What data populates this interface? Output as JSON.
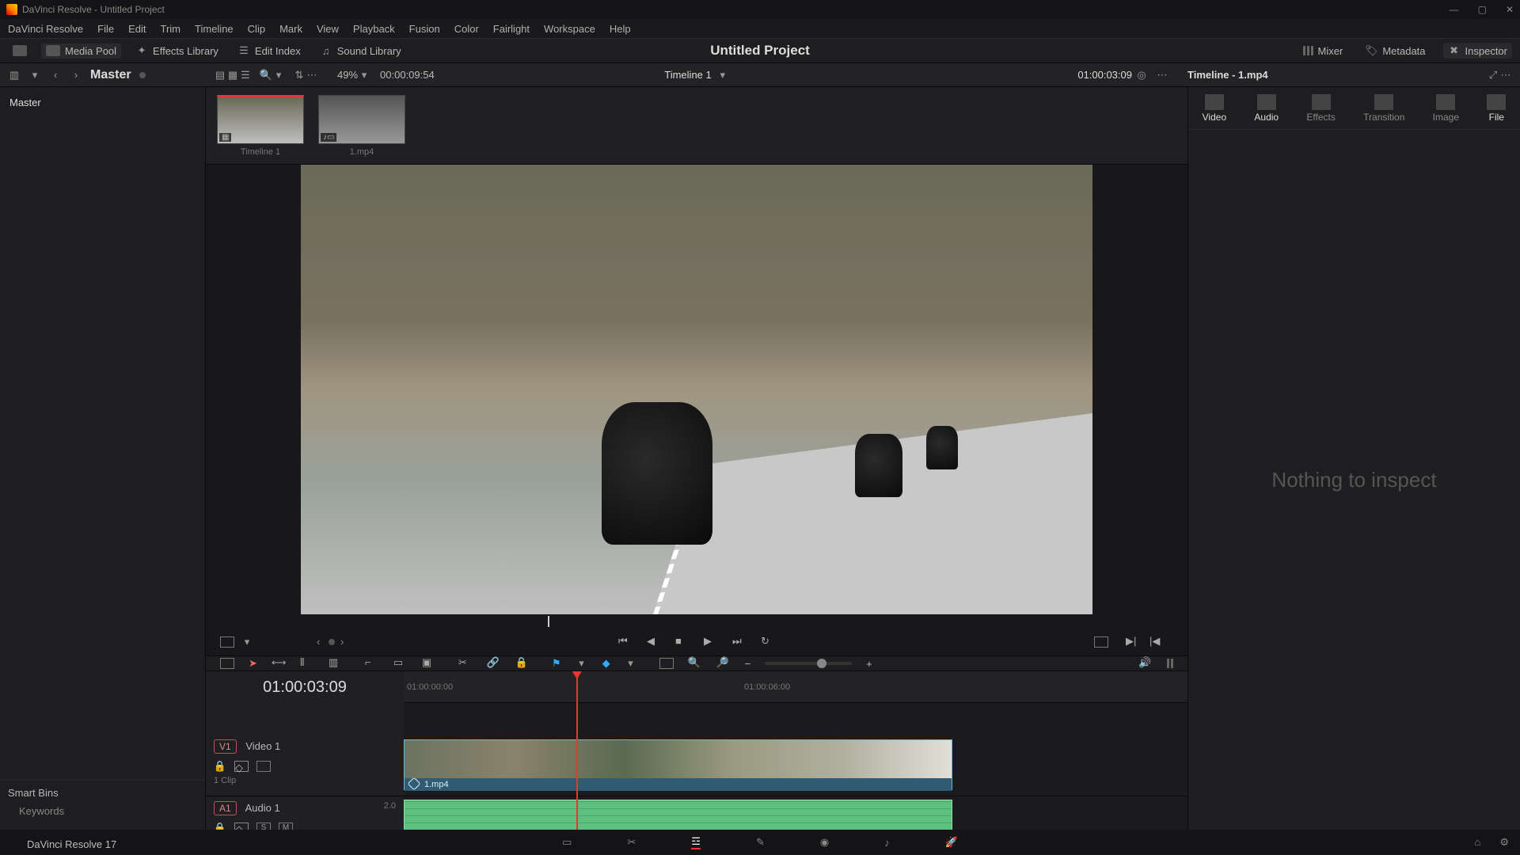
{
  "titlebar": {
    "text": "DaVinci Resolve - Untitled Project"
  },
  "menu": [
    "DaVinci Resolve",
    "File",
    "Edit",
    "Trim",
    "Timeline",
    "Clip",
    "Mark",
    "View",
    "Playback",
    "Fusion",
    "Color",
    "Fairlight",
    "Workspace",
    "Help"
  ],
  "toolbar1": {
    "media_pool": "Media Pool",
    "effects_lib": "Effects Library",
    "edit_index": "Edit Index",
    "sound_lib": "Sound Library",
    "project_title": "Untitled Project",
    "mixer": "Mixer",
    "metadata": "Metadata",
    "inspector": "Inspector"
  },
  "toolbar2": {
    "bin_label": "Master",
    "zoom_pct": "49%",
    "src_tc": "00:00:09:54",
    "timeline_name": "Timeline 1",
    "rec_tc": "01:00:03:09",
    "inspector_title": "Timeline - 1.mp4"
  },
  "media": {
    "bin_root": "Master",
    "items": [
      {
        "name": "Timeline 1",
        "type": "timeline"
      },
      {
        "name": "1.mp4",
        "type": "clip"
      }
    ],
    "smart_bins_label": "Smart Bins",
    "keywords_label": "Keywords"
  },
  "timeline": {
    "tc": "01:00:03:09",
    "ruler_marks": [
      "01:00:00:00",
      "01:00:06:00"
    ],
    "tracks": {
      "v1": {
        "badge": "V1",
        "name": "Video 1",
        "clips_label": "1 Clip"
      },
      "a1": {
        "badge": "A1",
        "name": "Audio 1",
        "ch": "2.0"
      }
    },
    "clip_name": "1.mp4",
    "playhead_pct": 31,
    "clip_start_pct": 0,
    "clip_end_pct": 70
  },
  "inspector": {
    "tabs": [
      "Video",
      "Audio",
      "Effects",
      "Transition",
      "Image",
      "File"
    ],
    "active_tab": 0,
    "empty_msg": "Nothing to inspect"
  },
  "bottom_nav": [
    "media",
    "cut",
    "edit",
    "fusion",
    "color",
    "fairlight",
    "deliver"
  ],
  "app_footer": "DaVinci Resolve 17"
}
